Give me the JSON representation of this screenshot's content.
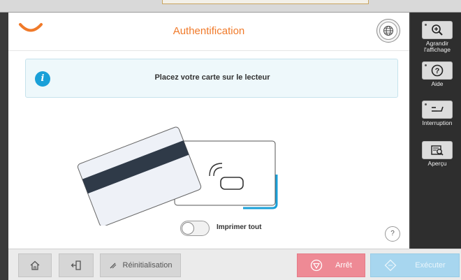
{
  "header": {
    "title": "Authentification"
  },
  "message": {
    "text": "Placez votre carte sur le lecteur",
    "icon": "info-icon"
  },
  "print_all": {
    "label": "Imprimer tout",
    "enabled": false
  },
  "help_small": {
    "label": "?"
  },
  "sidebar": {
    "items": [
      {
        "label": "Agrandir l'affichage",
        "icon": "zoom-in-icon"
      },
      {
        "label": "Aide",
        "icon": "help-icon"
      },
      {
        "label": "Interruption",
        "icon": "interruption-icon"
      },
      {
        "label": "Aperçu",
        "icon": "preview-icon"
      }
    ]
  },
  "footer": {
    "reset_label": "Réinitialisation",
    "stop_label": "Arrêt",
    "start_label": "Exécuter"
  },
  "colors": {
    "accent": "#f07a2a",
    "info": "#1aa0d8",
    "stop": "#ee8a95",
    "start": "#a7d6ef"
  }
}
